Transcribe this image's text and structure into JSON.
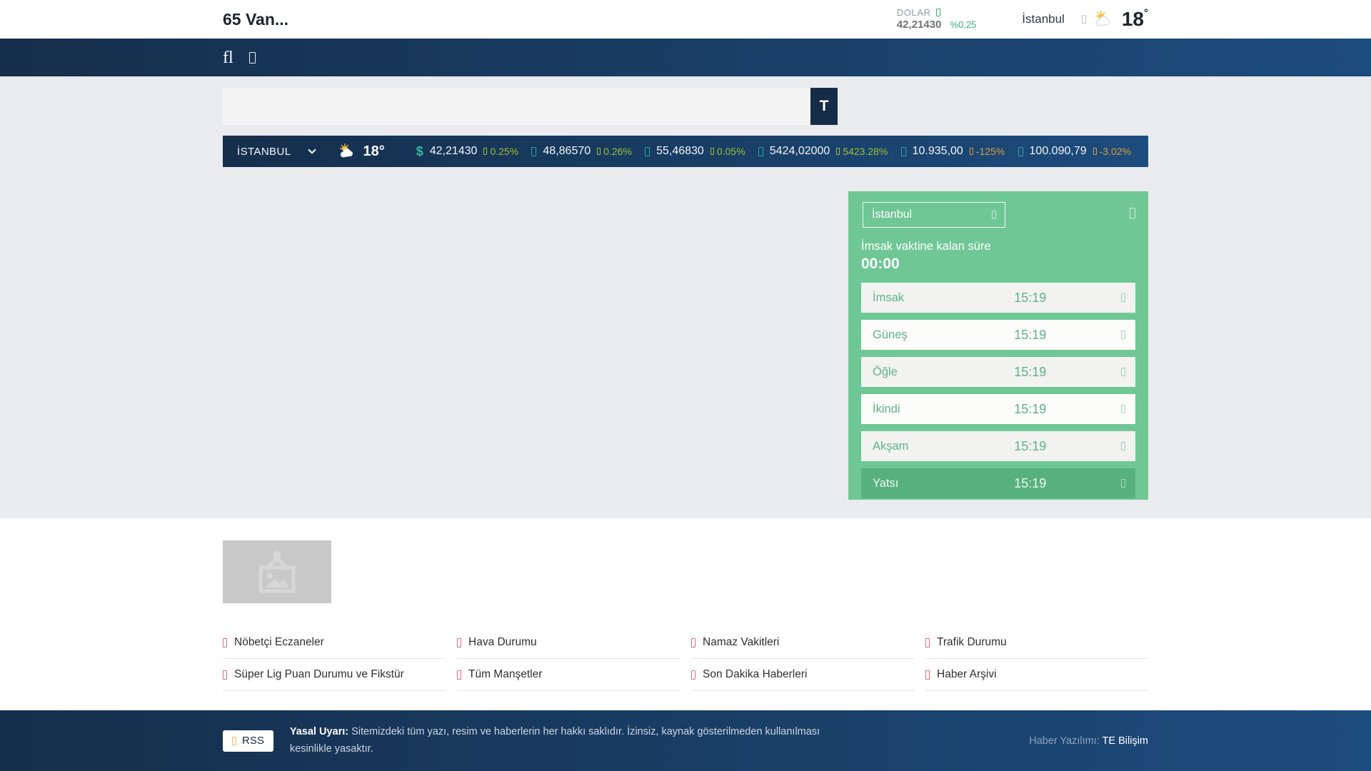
{
  "header": {
    "site_title": "65 Van...",
    "dolar_label": "DOLAR",
    "dolar_value": "42,21430",
    "dolar_change": "%0.25",
    "city": "İstanbul",
    "temperature": "18",
    "degree": "°"
  },
  "nav": {
    "search_icon_fallback": "fl"
  },
  "search": {
    "placeholder": "",
    "value": "",
    "button_label": "T"
  },
  "ticker": {
    "city": "İSTANBUL",
    "temperature": "18°",
    "items": [
      {
        "symbol": "$",
        "value": "42,21430",
        "change": "0.25%",
        "direction": "up"
      },
      {
        "value": "48,86570",
        "change": "0.26%",
        "direction": "up"
      },
      {
        "value": "55,46830",
        "change": "0.05%",
        "direction": "up"
      },
      {
        "value": "5424,02000",
        "change": "5423.28%",
        "direction": "up"
      },
      {
        "value": "10.935,00",
        "change": "-125%",
        "direction": "down"
      },
      {
        "value": "100.090,79",
        "change": "-3.02%",
        "direction": "down"
      }
    ]
  },
  "prayer_widget": {
    "city_select_value": "İstanbul",
    "countdown_label": "İmsak vaktine kalan süre",
    "countdown_value": "00:00",
    "times": [
      {
        "name": "İmsak",
        "time": "15:19"
      },
      {
        "name": "Güneş",
        "time": "15:19"
      },
      {
        "name": "Öğle",
        "time": "15:19"
      },
      {
        "name": "İkindi",
        "time": "15:19"
      },
      {
        "name": "Akşam",
        "time": "15:19"
      },
      {
        "name": "Yatsı",
        "time": "15:19",
        "active": true
      }
    ]
  },
  "footer_links": [
    {
      "label": "Nöbetçi Eczaneler"
    },
    {
      "label": "Hava Durumu"
    },
    {
      "label": "Namaz Vakitleri"
    },
    {
      "label": "Trafik Durumu"
    },
    {
      "label": "Süper Lig Puan Durumu ve Fikstür"
    },
    {
      "label": "Tüm Manşetler"
    },
    {
      "label": "Son Dakika Haberleri"
    },
    {
      "label": "Haber Arşivi"
    }
  ],
  "bottom_footer": {
    "rss_label": "RSS",
    "legal_bold": "Yasal Uyarı:",
    "legal_text": " Sitemizdeki tüm yazı, resim ve haberlerin her hakkı saklıdır. İzinsiz, kaynak gösterilmeden kullanılması kesinlikle yasaktır.",
    "credit_label": "Haber Yazılımı: ",
    "credit_value": "TE Bilişim"
  },
  "colors": {
    "navy_dark": "#152e4b",
    "navy_light": "#1d4c7e",
    "page_gray": "#e9ebee",
    "widget_green": "#6fc795",
    "active_row_green": "#57b17e",
    "up_change": "#9fc131",
    "down_change": "#d8a137",
    "teal_currency": "#2ba89e",
    "link_icon_red": "#e0697a",
    "positive_green": "#3bb273"
  }
}
